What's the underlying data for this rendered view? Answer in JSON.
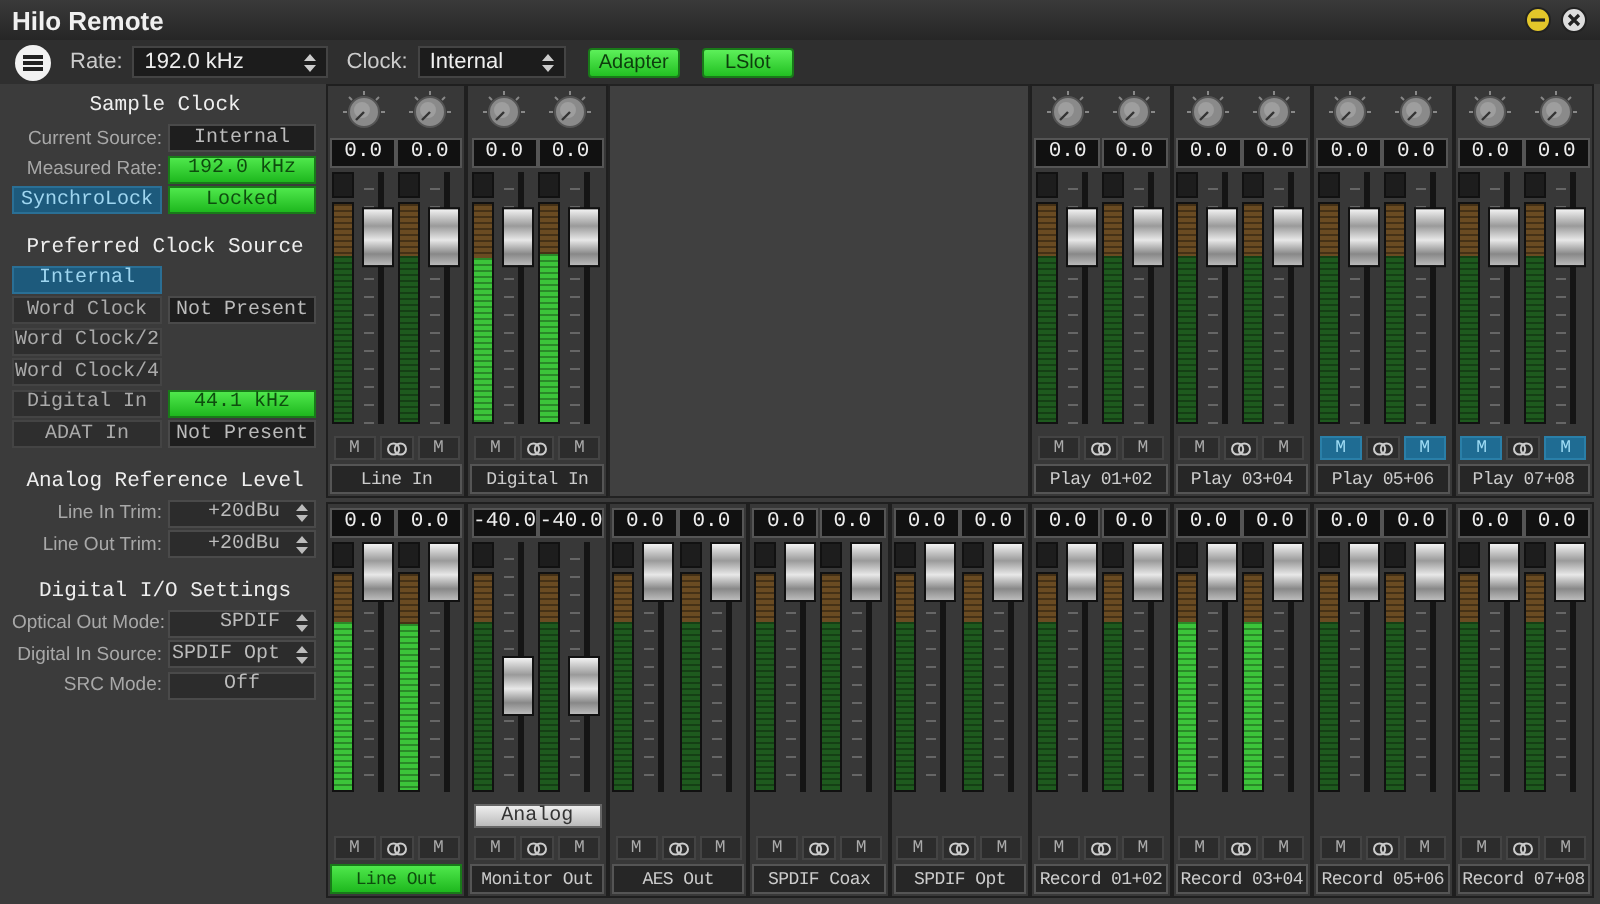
{
  "window": {
    "title": "Hilo Remote"
  },
  "toolbar": {
    "rate": {
      "label": "Rate:",
      "value": "192.0 kHz"
    },
    "clock": {
      "label": "Clock:",
      "value": "Internal"
    },
    "buttons": [
      "Adapter",
      "LSlot"
    ]
  },
  "sample_clock": {
    "title": "Sample Clock",
    "rows": [
      {
        "kind": "readout",
        "label": "Current Source:",
        "value": "Internal",
        "active": false
      },
      {
        "kind": "readout",
        "label": "Measured Rate:",
        "value": "192.0 kHz",
        "active": true
      },
      {
        "kind": "button",
        "label": "SynchroLock",
        "value": "Locked",
        "active": true
      }
    ]
  },
  "preferred_clock_source": {
    "title": "Preferred Clock Source",
    "options": [
      {
        "label": "Internal",
        "selected": true
      },
      {
        "label": "Word Clock",
        "selected": false,
        "status": "Not Present",
        "active": false
      },
      {
        "label": "Word Clock/2",
        "selected": false
      },
      {
        "label": "Word Clock/4",
        "selected": false
      },
      {
        "label": "Digital In",
        "selected": false,
        "status": "44.1 kHz",
        "active": true
      },
      {
        "label": "ADAT In",
        "selected": false,
        "status": "Not Present",
        "active": false
      }
    ]
  },
  "analog_reference_level": {
    "title": "Analog Reference Level",
    "settings": [
      {
        "kind": "select",
        "label": "Line In Trim:",
        "value": "+20dBu"
      },
      {
        "kind": "select",
        "label": "Line Out Trim:",
        "value": "+20dBu"
      }
    ]
  },
  "digital_io_settings": {
    "title": "Digital I/O Settings",
    "settings": [
      {
        "kind": "select",
        "label": "Optical Out Mode:",
        "value": "SPDIF"
      },
      {
        "kind": "select",
        "label": "Digital In Source:",
        "value": "SPDIF Opt"
      },
      {
        "kind": "button",
        "label": "SRC Mode:",
        "value": "Off"
      }
    ]
  },
  "mixer": {
    "top_strips": [
      {
        "label": "Line In",
        "selected": false,
        "channels": [
          {
            "value": "0.0",
            "fader": {
              "level": 0.82
            },
            "meter": {
              "level": 0.76,
              "active": false
            },
            "mute": {
              "label": "M",
              "on": false
            }
          },
          {
            "value": "0.0",
            "fader": {
              "level": 0.82
            },
            "meter": {
              "level": 0.76,
              "active": false
            },
            "mute": {
              "label": "M",
              "on": false
            }
          }
        ]
      },
      {
        "label": "Digital In",
        "selected": false,
        "channels": [
          {
            "value": "0.0",
            "fader": {
              "level": 0.82
            },
            "meter": {
              "level": 0.75,
              "active": true
            },
            "mute": {
              "label": "M",
              "on": false
            }
          },
          {
            "value": "0.0",
            "fader": {
              "level": 0.82
            },
            "meter": {
              "level": 0.77,
              "active": true
            },
            "mute": {
              "label": "M",
              "on": false
            }
          }
        ]
      },
      {
        "label": "Play 01+02",
        "selected": false,
        "channels": [
          {
            "value": "0.0",
            "fader": {
              "level": 0.82
            },
            "meter": {
              "level": 0.76,
              "active": false
            },
            "mute": {
              "label": "M",
              "on": false
            }
          },
          {
            "value": "0.0",
            "fader": {
              "level": 0.82
            },
            "meter": {
              "level": 0.76,
              "active": false
            },
            "mute": {
              "label": "M",
              "on": false
            }
          }
        ]
      },
      {
        "label": "Play 03+04",
        "selected": false,
        "channels": [
          {
            "value": "0.0",
            "fader": {
              "level": 0.82
            },
            "meter": {
              "level": 0.76,
              "active": false
            },
            "mute": {
              "label": "M",
              "on": false
            }
          },
          {
            "value": "0.0",
            "fader": {
              "level": 0.82
            },
            "meter": {
              "level": 0.76,
              "active": false
            },
            "mute": {
              "label": "M",
              "on": false
            }
          }
        ]
      },
      {
        "label": "Play 05+06",
        "selected": false,
        "channels": [
          {
            "value": "0.0",
            "fader": {
              "level": 0.82
            },
            "meter": {
              "level": 0.76,
              "active": false
            },
            "mute": {
              "label": "M",
              "on": true
            }
          },
          {
            "value": "0.0",
            "fader": {
              "level": 0.82
            },
            "meter": {
              "level": 0.76,
              "active": false
            },
            "mute": {
              "label": "M",
              "on": true
            }
          }
        ]
      },
      {
        "label": "Play 07+08",
        "selected": false,
        "channels": [
          {
            "value": "0.0",
            "fader": {
              "level": 0.82
            },
            "meter": {
              "level": 0.76,
              "active": false
            },
            "mute": {
              "label": "M",
              "on": true
            }
          },
          {
            "value": "0.0",
            "fader": {
              "level": 0.82
            },
            "meter": {
              "level": 0.76,
              "active": false
            },
            "mute": {
              "label": "M",
              "on": true
            }
          }
        ]
      }
    ],
    "bottom_strips": [
      {
        "label": "Line Out",
        "selected": true,
        "channels": [
          {
            "value": "0.0",
            "fader": {
              "level": 1
            },
            "meter": {
              "level": 0.78,
              "active": true
            },
            "mute": {
              "label": "M",
              "on": false
            }
          },
          {
            "value": "0.0",
            "fader": {
              "level": 1
            },
            "meter": {
              "level": 0.77,
              "active": true
            },
            "mute": {
              "label": "M",
              "on": false
            }
          }
        ]
      },
      {
        "label": "Monitor Out",
        "selected": false,
        "extra_button": "Analog",
        "channels": [
          {
            "value": "-40.0",
            "fader": {
              "level": 0.4
            },
            "meter": {
              "level": 0.78,
              "active": false
            },
            "mute": {
              "label": "M",
              "on": false
            }
          },
          {
            "value": "-40.0",
            "fader": {
              "level": 0.4
            },
            "meter": {
              "level": 0.78,
              "active": false
            },
            "mute": {
              "label": "M",
              "on": false
            }
          }
        ]
      },
      {
        "label": "AES Out",
        "selected": false,
        "channels": [
          {
            "value": "0.0",
            "fader": {
              "level": 1
            },
            "meter": {
              "level": 0.78,
              "active": false
            },
            "mute": {
              "label": "M",
              "on": false
            }
          },
          {
            "value": "0.0",
            "fader": {
              "level": 1
            },
            "meter": {
              "level": 0.78,
              "active": false
            },
            "mute": {
              "label": "M",
              "on": false
            }
          }
        ]
      },
      {
        "label": "SPDIF Coax",
        "selected": false,
        "channels": [
          {
            "value": "0.0",
            "fader": {
              "level": 1
            },
            "meter": {
              "level": 0.78,
              "active": false
            },
            "mute": {
              "label": "M",
              "on": false
            }
          },
          {
            "value": "0.0",
            "fader": {
              "level": 1
            },
            "meter": {
              "level": 0.78,
              "active": false
            },
            "mute": {
              "label": "M",
              "on": false
            }
          }
        ]
      },
      {
        "label": "SPDIF Opt",
        "selected": false,
        "channels": [
          {
            "value": "0.0",
            "fader": {
              "level": 1
            },
            "meter": {
              "level": 0.78,
              "active": false
            },
            "mute": {
              "label": "M",
              "on": false
            }
          },
          {
            "value": "0.0",
            "fader": {
              "level": 1
            },
            "meter": {
              "level": 0.78,
              "active": false
            },
            "mute": {
              "label": "M",
              "on": false
            }
          }
        ]
      },
      {
        "label": "Record 01+02",
        "selected": false,
        "channels": [
          {
            "value": "0.0",
            "fader": {
              "level": 1
            },
            "meter": {
              "level": 0.78,
              "active": false
            },
            "mute": {
              "label": "M",
              "on": false
            }
          },
          {
            "value": "0.0",
            "fader": {
              "level": 1
            },
            "meter": {
              "level": 0.78,
              "active": false
            },
            "mute": {
              "label": "M",
              "on": false
            }
          }
        ]
      },
      {
        "label": "Record 03+04",
        "selected": false,
        "channels": [
          {
            "value": "0.0",
            "fader": {
              "level": 1
            },
            "meter": {
              "level": 0.78,
              "active": true
            },
            "mute": {
              "label": "M",
              "on": false
            }
          },
          {
            "value": "0.0",
            "fader": {
              "level": 1
            },
            "meter": {
              "level": 0.78,
              "active": true
            },
            "mute": {
              "label": "M",
              "on": false
            }
          }
        ]
      },
      {
        "label": "Record 05+06",
        "selected": false,
        "channels": [
          {
            "value": "0.0",
            "fader": {
              "level": 1
            },
            "meter": {
              "level": 0.78,
              "active": false
            },
            "mute": {
              "label": "M",
              "on": false
            }
          },
          {
            "value": "0.0",
            "fader": {
              "level": 1
            },
            "meter": {
              "level": 0.78,
              "active": false
            },
            "mute": {
              "label": "M",
              "on": false
            }
          }
        ]
      },
      {
        "label": "Record 07+08",
        "selected": false,
        "channels": [
          {
            "value": "0.0",
            "fader": {
              "level": 1
            },
            "meter": {
              "level": 0.78,
              "active": false
            },
            "mute": {
              "label": "M",
              "on": false
            }
          },
          {
            "value": "0.0",
            "fader": {
              "level": 1
            },
            "meter": {
              "level": 0.78,
              "active": false
            },
            "mute": {
              "label": "M",
              "on": false
            }
          }
        ]
      }
    ]
  }
}
